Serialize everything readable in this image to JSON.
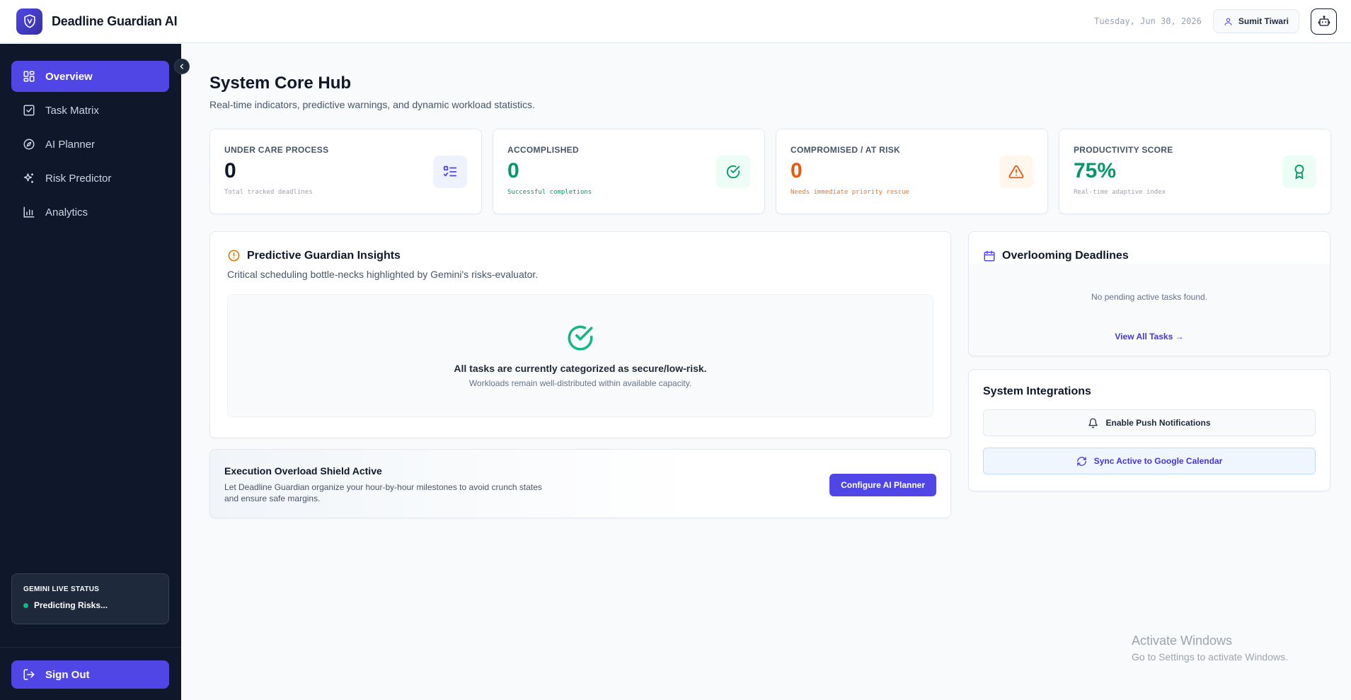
{
  "header": {
    "app_title": "Deadline Guardian AI",
    "date": "Tuesday, Jun 30, 2026",
    "user_name": "Sumit Tiwari"
  },
  "sidebar": {
    "items": [
      {
        "label": "Overview",
        "icon": "grid-icon",
        "active": true
      },
      {
        "label": "Task Matrix",
        "icon": "checkbox-icon",
        "active": false
      },
      {
        "label": "AI Planner",
        "icon": "compass-icon",
        "active": false
      },
      {
        "label": "Risk Predictor",
        "icon": "sparkles-icon",
        "active": false
      },
      {
        "label": "Analytics",
        "icon": "bar-chart-icon",
        "active": false
      }
    ],
    "status_title": "GEMINI LIVE STATUS",
    "status_text": "Predicting Risks...",
    "sign_out": "Sign Out"
  },
  "page": {
    "title": "System Core Hub",
    "subtitle": "Real-time indicators, predictive warnings, and dynamic workload statistics."
  },
  "stats": [
    {
      "label": "UNDER CARE PROCESS",
      "value": "0",
      "note": "Total tracked deadlines",
      "value_color": "#0f172a",
      "note_color": "#94a3b8",
      "icon": "list-check-icon",
      "icon_bg": "#eef2ff",
      "icon_color": "#4f46e5"
    },
    {
      "label": "ACCOMPLISHED",
      "value": "0",
      "note": "Successful completions",
      "value_color": "#059669",
      "note_color": "#059669",
      "icon": "check-circle-icon",
      "icon_bg": "#ecfdf5",
      "icon_color": "#059669"
    },
    {
      "label": "COMPROMISED / AT RISK",
      "value": "0",
      "note": "Needs immediate priority rescue",
      "value_color": "#ea580c",
      "note_color": "#f97316",
      "icon": "warning-icon",
      "icon_bg": "#fff7ed",
      "icon_color": "#ea580c"
    },
    {
      "label": "PRODUCTIVITY SCORE",
      "value": "75%",
      "note": "Real-time adaptive index",
      "value_color": "#059669",
      "note_color": "#94a3b8",
      "icon": "award-icon",
      "icon_bg": "#ecfdf5",
      "icon_color": "#059669"
    }
  ],
  "insights": {
    "title": "Predictive Guardian Insights",
    "subtitle": "Critical scheduling bottle-necks highlighted by Gemini's risks-evaluator.",
    "empty_title": "All tasks are currently categorized as secure/low-risk.",
    "empty_desc": "Workloads remain well-distributed within available capacity."
  },
  "shield": {
    "title": "Execution Overload Shield Active",
    "desc": "Let Deadline Guardian organize your hour-by-hour milestones to avoid crunch states and ensure safe margins.",
    "button": "Configure AI Planner"
  },
  "deadlines": {
    "title": "Overlooming Deadlines",
    "empty": "No pending active tasks found.",
    "link": "View All Tasks →"
  },
  "integrations": {
    "title": "System Integrations",
    "push": "Enable Push Notifications",
    "sync": "Sync Active to Google Calendar"
  },
  "watermark": {
    "title": "Activate Windows",
    "sub": "Go to Settings to activate Windows."
  }
}
